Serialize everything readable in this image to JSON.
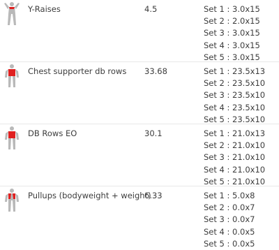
{
  "workout": {
    "exercises": [
      {
        "name": "Y-Raises",
        "weight": "4.5",
        "sets": [
          "Set 1 : 3.0x15",
          "Set 2 : 2.0x15",
          "Set 3 : 3.0x15",
          "Set 4 : 3.0x15",
          "Set 5 : 3.0x15"
        ]
      },
      {
        "name": "Chest supporter db rows",
        "weight": "33.68",
        "sets": [
          "Set 1 : 23.5x13",
          "Set 2 : 23.5x10",
          "Set 3 : 23.5x10",
          "Set 4 : 23.5x10",
          "Set 5 : 23.5x10"
        ]
      },
      {
        "name": "DB Rows EO",
        "weight": "30.1",
        "sets": [
          "Set 1 : 21.0x13",
          "Set 2 : 21.0x10",
          "Set 3 : 21.0x10",
          "Set 4 : 21.0x10",
          "Set 5 : 21.0x10"
        ]
      },
      {
        "name": "Pullups (bodyweight + weight)",
        "weight": "6.33",
        "sets": [
          "Set 1 : 5.0x8",
          "Set 2 : 0.0x7",
          "Set 3 : 0.0x7",
          "Set 4 : 0.0x5",
          "Set 5 : 0.0x5"
        ]
      }
    ]
  },
  "colors": {
    "muscle_highlight": "#e02020",
    "body": "#b9b9b9",
    "text": "#3c3c3c"
  },
  "icons": {
    "exercise": "muscle-figure-icon"
  }
}
